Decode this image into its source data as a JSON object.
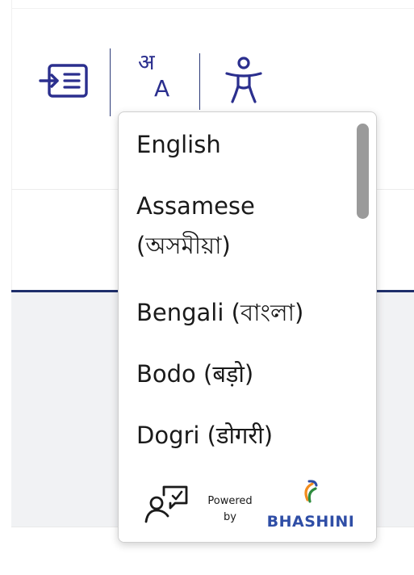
{
  "toolbar": {
    "translate_glyph_hindi": "अ",
    "translate_glyph_latin": "A"
  },
  "language_menu": {
    "items": [
      {
        "label": "English"
      },
      {
        "label": "Assamese (অসমীয়া)"
      },
      {
        "label": "Bengali (বাংলা)"
      },
      {
        "label": "Bodo (बड़ो)"
      },
      {
        "label": "Dogri (डोगरी)"
      }
    ],
    "powered_by": "Powered by",
    "brand": "BHASHINI"
  },
  "colors": {
    "accent": "#2b2f8e",
    "nav_underline": "#1f2f6b",
    "brand_blue": "#2f4ea6",
    "brand_orange": "#f28c1e",
    "brand_green": "#2e8b3e"
  }
}
